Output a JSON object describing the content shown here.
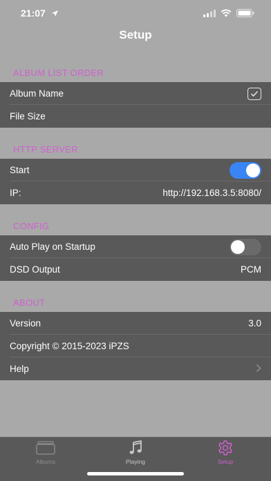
{
  "status_bar": {
    "time": "21:07"
  },
  "nav": {
    "title": "Setup"
  },
  "sections": {
    "album_list_order": {
      "header": "ALBUM LIST ORDER",
      "rows": [
        "Album Name",
        "File Size"
      ]
    },
    "http_server": {
      "header": "HTTP SERVER",
      "start_label": "Start",
      "ip_label": "IP:",
      "ip_value": "http://192.168.3.5:8080/"
    },
    "config": {
      "header": "CONFIG",
      "auto_play_label": "Auto Play on Startup",
      "dsd_label": "DSD Output",
      "dsd_value": "PCM"
    },
    "about": {
      "header": "ABOUT",
      "version_label": "Version",
      "version_value": "3.0",
      "copyright": "Copyright © 2015-2023  iPZS",
      "help_label": "Help"
    }
  },
  "toggles": {
    "http_start_on": true,
    "auto_play_on": false
  },
  "tabs": [
    {
      "label": "Albums",
      "icon": "albums-icon"
    },
    {
      "label": "Playing",
      "icon": "music-note-icon"
    },
    {
      "label": "Setup",
      "icon": "gear-icon"
    }
  ],
  "colors": {
    "accent": "#d060d0",
    "toggle_on": "#3a84f6",
    "toggle_off": "#6a6a6a",
    "row_bg": "#595959",
    "page_bg": "#a9a9a9"
  }
}
